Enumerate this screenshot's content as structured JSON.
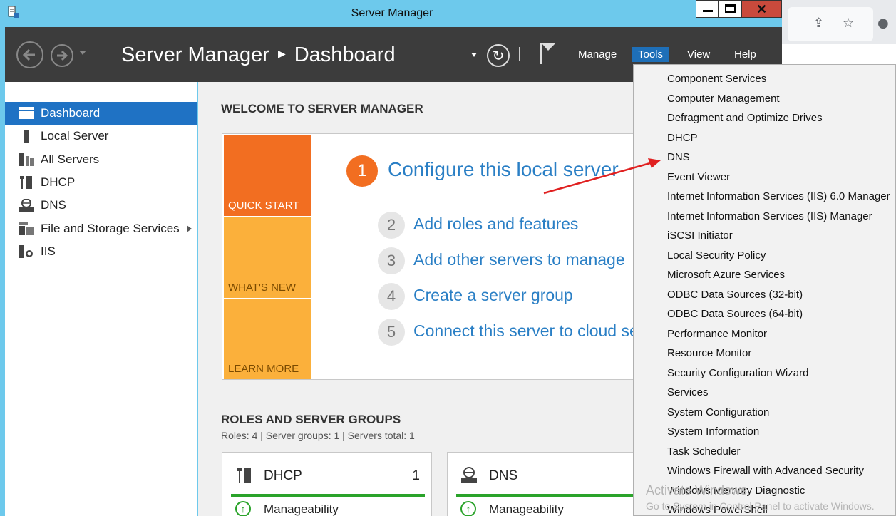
{
  "window": {
    "title": "Server Manager"
  },
  "header": {
    "breadcrumb_root": "Server Manager",
    "breadcrumb_page": "Dashboard",
    "menus": {
      "manage": "Manage",
      "tools": "Tools",
      "view": "View",
      "help": "Help"
    }
  },
  "sidebar": {
    "items": [
      {
        "label": "Dashboard",
        "icon": "dashboard-icon",
        "active": true
      },
      {
        "label": "Local Server",
        "icon": "server-icon"
      },
      {
        "label": "All Servers",
        "icon": "servers-icon"
      },
      {
        "label": "DHCP",
        "icon": "dhcp-icon"
      },
      {
        "label": "DNS",
        "icon": "dns-icon"
      },
      {
        "label": "File and Storage Services",
        "icon": "storage-icon"
      },
      {
        "label": "IIS",
        "icon": "iis-icon"
      }
    ]
  },
  "welcome": {
    "heading": "WELCOME TO SERVER MANAGER",
    "tiles": {
      "quick_start": "QUICK START",
      "whats_new": "WHAT'S NEW",
      "learn_more": "LEARN MORE"
    },
    "steps": [
      {
        "num": "1",
        "text": "Configure this local server"
      },
      {
        "num": "2",
        "text": "Add roles and features"
      },
      {
        "num": "3",
        "text": "Add other servers to manage"
      },
      {
        "num": "4",
        "text": "Create a server group"
      },
      {
        "num": "5",
        "text": "Connect this server to cloud services"
      }
    ]
  },
  "roles": {
    "heading": "ROLES AND SERVER GROUPS",
    "summary": "Roles: 4  |  Server groups: 1  |  Servers total: 1",
    "cards": [
      {
        "title": "DHCP",
        "count": "1",
        "status": "Manageability"
      },
      {
        "title": "DNS",
        "count": "",
        "status": "Manageability"
      }
    ]
  },
  "tools_menu": {
    "items": [
      "Component Services",
      "Computer Management",
      "Defragment and Optimize Drives",
      "DHCP",
      "DNS",
      "Event Viewer",
      "Internet Information Services (IIS) 6.0 Manager",
      "Internet Information Services (IIS) Manager",
      "iSCSI Initiator",
      "Local Security Policy",
      "Microsoft Azure Services",
      "ODBC Data Sources (32-bit)",
      "ODBC Data Sources (64-bit)",
      "Performance Monitor",
      "Resource Monitor",
      "Security Configuration Wizard",
      "Services",
      "System Configuration",
      "System Information",
      "Task Scheduler",
      "Windows Firewall with Advanced Security",
      "Windows Memory Diagnostic",
      "Windows PowerShell"
    ]
  },
  "watermark": {
    "line1": "Activate Windows",
    "line2": "Go to System in Control Panel to activate Windows."
  },
  "colors": {
    "accent": "#1f72c4",
    "quick_start": "#f26e21",
    "tile_light": "#fbb03b",
    "header": "#3c3c3c",
    "titlebar": "#6dc9ec",
    "annotation_arrow": "#e02020"
  }
}
